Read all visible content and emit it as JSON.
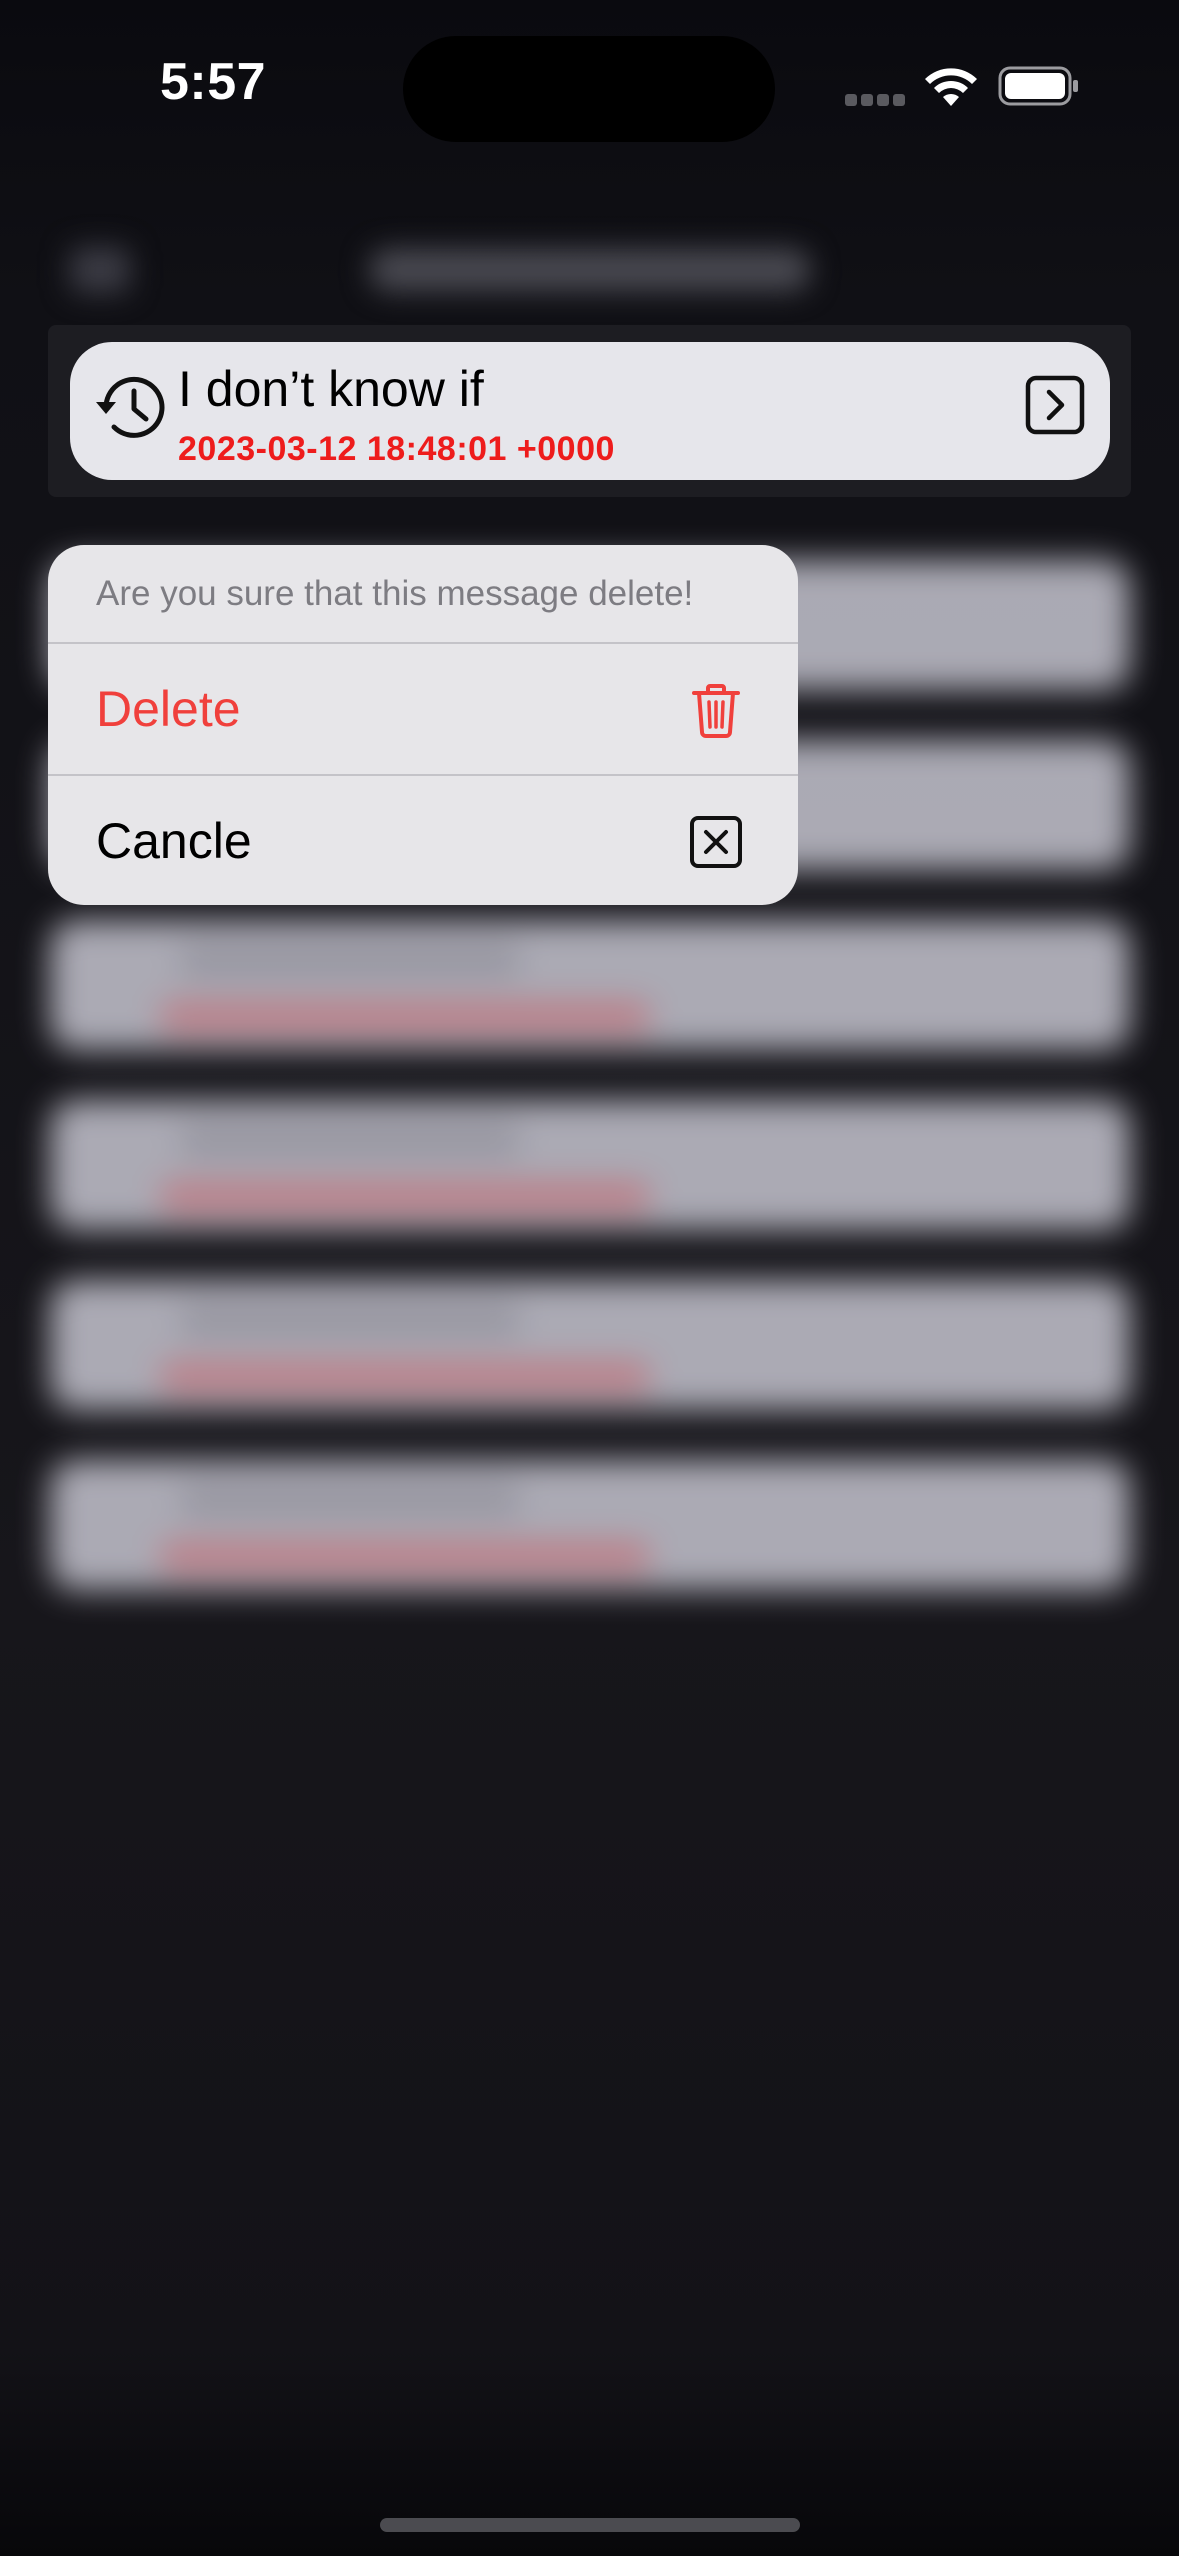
{
  "status_bar": {
    "time": "5:57"
  },
  "focused_message": {
    "title": "I don’t know if",
    "timestamp": "2023-03-12 18:48:01 +0000",
    "icon": "history-icon",
    "action_icon": "chevron-right-square-icon"
  },
  "context_menu": {
    "header": "Are you sure that this message delete!",
    "items": [
      {
        "label": "Delete",
        "icon": "trash-icon",
        "color": "#f0403c"
      },
      {
        "label": "Cancle",
        "icon": "close-square-icon",
        "color": "#000000"
      }
    ]
  },
  "colors": {
    "accent_red": "#ee1c1c",
    "card_background": "#e6e6eb",
    "menu_background": "#e7e6e9"
  }
}
